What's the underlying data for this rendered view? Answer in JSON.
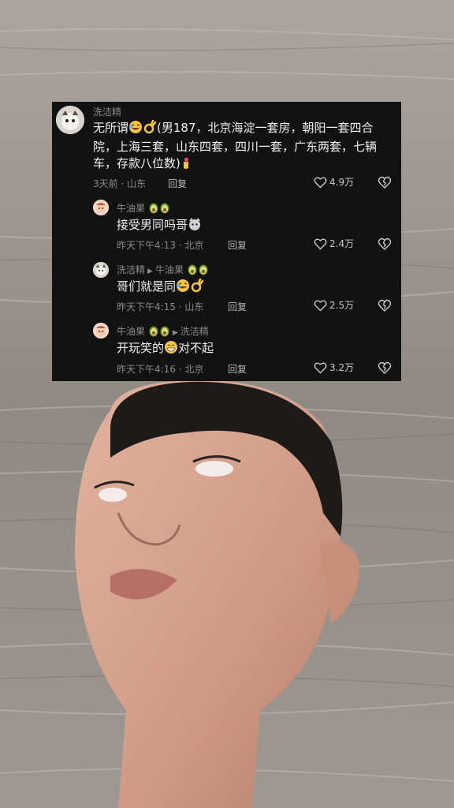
{
  "comments": [
    {
      "author": "洗洁精",
      "text_prefix": "无所谓",
      "text_body": "(男187，北京海淀一套房，朝阳一套四合院，上海三套，山东四套，四川一套，广东两套，七辆车，存款八位数)",
      "meta": "3天前 · 山东",
      "reply_label": "回复",
      "likes": "4.9万"
    },
    {
      "author": "牛油果",
      "text": "接受男同吗哥",
      "meta": "昨天下午4:13 · 北京",
      "reply_label": "回复",
      "likes": "2.4万"
    },
    {
      "author": "洗洁精",
      "reply_to": "牛油果",
      "text": "哥们就是同",
      "meta": "昨天下午4:15 · 山东",
      "reply_label": "回复",
      "likes": "2.5万"
    },
    {
      "author": "牛油果",
      "reply_to": "洗洁精",
      "text_prefix": "开玩笑的",
      "text_suffix": "对不起",
      "meta": "昨天下午4:16 · 北京",
      "reply_label": "回复",
      "likes": "3.2万"
    }
  ],
  "icons": {
    "like": "heart-outline-icon",
    "dislike": "broken-heart-icon"
  },
  "colors": {
    "overlay_bg": "#121212",
    "muted_text": "#8a8a8a"
  }
}
